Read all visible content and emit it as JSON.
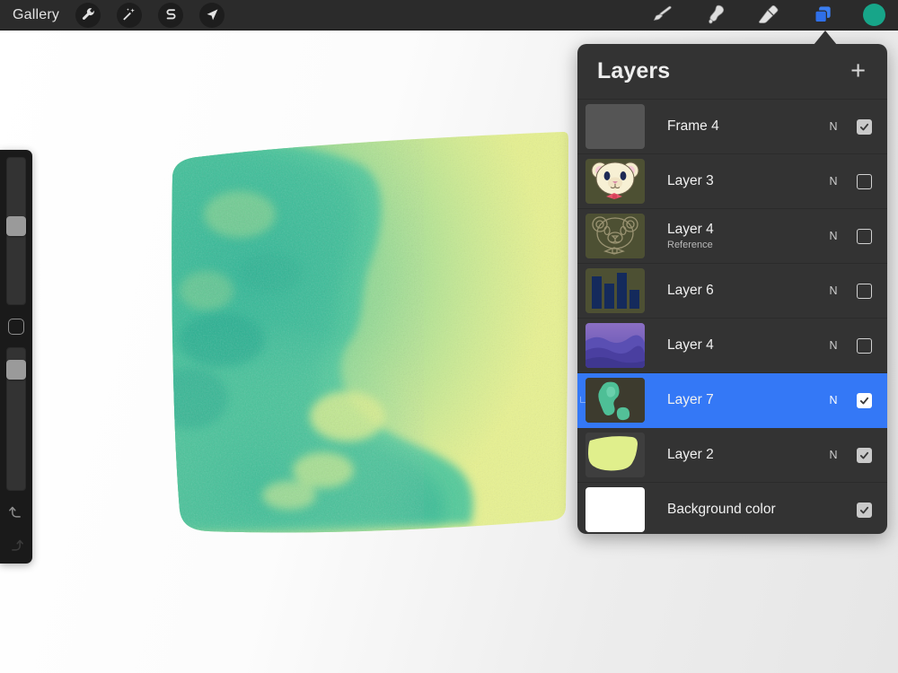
{
  "app": {
    "background_color": "#e8e8e8"
  },
  "toolbar": {
    "gallery_label": "Gallery",
    "left_tools": [
      {
        "name": "wrench-icon",
        "label": "Actions"
      },
      {
        "name": "magic-wand-icon",
        "label": "Adjustments"
      },
      {
        "name": "s-curve-icon",
        "label": "Selection"
      },
      {
        "name": "arrow-transform-icon",
        "label": "Transform"
      }
    ],
    "right_tools": [
      {
        "name": "paintbrush-icon",
        "label": "Paint"
      },
      {
        "name": "smudge-icon",
        "label": "Smudge"
      },
      {
        "name": "eraser-icon",
        "label": "Erase"
      },
      {
        "name": "layers-icon",
        "label": "Layers",
        "active": true
      }
    ],
    "color_swatch": "#17a589",
    "layers_icon_color": "#3478f6"
  },
  "sidebar": {
    "brush_size_percent": 40,
    "opacity_percent": 8,
    "modify_button": "modify-square",
    "undo_label": "Undo",
    "redo_label": "Redo"
  },
  "layers_panel": {
    "title": "Layers",
    "add_label": "+",
    "selected_color": "#3478f6",
    "rows": [
      {
        "name": "Frame 4",
        "sub": "",
        "blend": "N",
        "visible": true,
        "selected": false,
        "clipped": false,
        "thumb": "empty-gray"
      },
      {
        "name": "Layer 3",
        "sub": "",
        "blend": "N",
        "visible": false,
        "selected": false,
        "clipped": false,
        "thumb": "bear-color"
      },
      {
        "name": "Layer 4",
        "sub": "Reference",
        "blend": "N",
        "visible": false,
        "selected": false,
        "clipped": false,
        "thumb": "bear-lineart"
      },
      {
        "name": "Layer 6",
        "sub": "",
        "blend": "N",
        "visible": false,
        "selected": false,
        "clipped": false,
        "thumb": "bar-chart"
      },
      {
        "name": "Layer 4",
        "sub": "",
        "blend": "N",
        "visible": false,
        "selected": false,
        "clipped": false,
        "thumb": "purple-mountains"
      },
      {
        "name": "Layer 7",
        "sub": "",
        "blend": "N",
        "visible": true,
        "selected": true,
        "clipped": true,
        "thumb": "green-blob"
      },
      {
        "name": "Layer 2",
        "sub": "",
        "blend": "N",
        "visible": true,
        "selected": false,
        "clipped": false,
        "thumb": "yellow-blob"
      },
      {
        "name": "Background color",
        "sub": "",
        "blend": "",
        "visible": true,
        "selected": false,
        "clipped": false,
        "thumb": "white"
      }
    ]
  },
  "canvas": {
    "artwork_name": "watercolor-blob",
    "base_color": "#e2ef8a",
    "wash_color": "#46c49a",
    "deep_color": "#2fae8f"
  }
}
